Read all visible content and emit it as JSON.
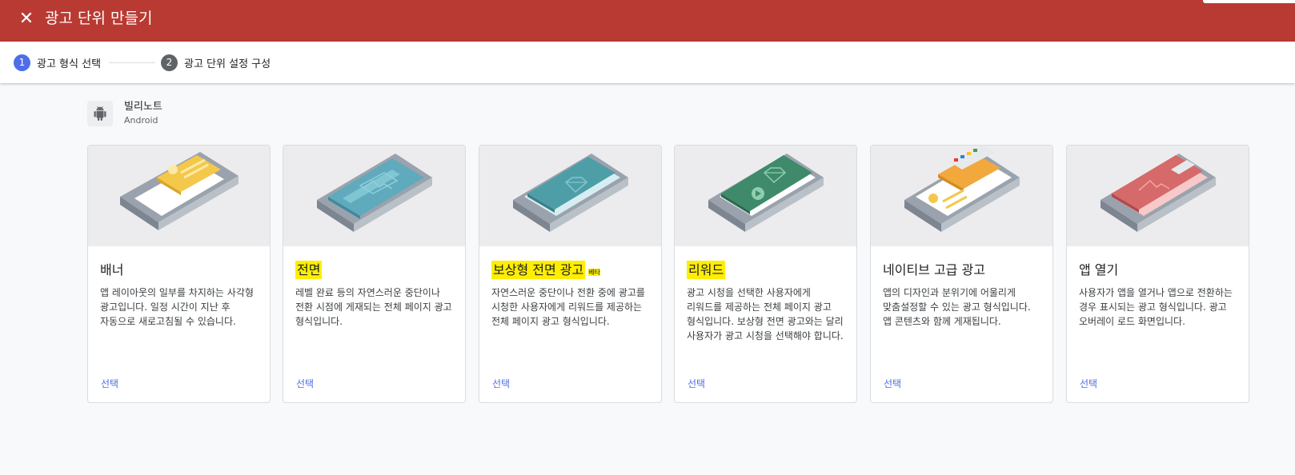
{
  "header": {
    "close_icon": "close-icon",
    "title": "광고 단위 만들기",
    "background": "#b93a32"
  },
  "stepper": {
    "steps": [
      {
        "number": "1",
        "label": "광고 형식 선택",
        "state": "active"
      },
      {
        "number": "2",
        "label": "광고 단위 설정 구성",
        "state": "inactive"
      }
    ]
  },
  "app": {
    "icon": "android-icon",
    "name": "빌리노트",
    "platform": "Android"
  },
  "cards": [
    {
      "title": "배너",
      "highlight": false,
      "badge": "",
      "description": "앱 레이아웃의 일부를 차지하는 사각형 광고입니다. 일정 시간이 지난 후 자동으로 새로고침될 수 있습니다.",
      "select_label": "선택",
      "illustration": "banner-illustration"
    },
    {
      "title": "전면",
      "highlight": true,
      "badge": "",
      "description": "레벨 완료 등의 자연스러운 중단이나 전환 시점에 게재되는 전체 페이지 광고 형식입니다.",
      "select_label": "선택",
      "illustration": "interstitial-illustration"
    },
    {
      "title": "보상형 전면 광고",
      "highlight": true,
      "badge": "베타",
      "description": "자연스러운 중단이나 전환 중에 광고를 시청한 사용자에게 리워드를 제공하는 전체 페이지 광고 형식입니다.",
      "select_label": "선택",
      "illustration": "rewarded-interstitial-illustration"
    },
    {
      "title": "리워드",
      "highlight": true,
      "badge": "",
      "description": "광고 시청을 선택한 사용자에게 리워드를 제공하는 전체 페이지 광고 형식입니다. 보상형 전면 광고와는 달리 사용자가 광고 시청을 선택해야 합니다.",
      "select_label": "선택",
      "illustration": "rewarded-illustration"
    },
    {
      "title": "네이티브 고급 광고",
      "highlight": false,
      "badge": "",
      "description": "앱의 디자인과 분위기에 어울리게 맞춤설정할 수 있는 광고 형식입니다. 앱 콘텐츠와 함께 게재됩니다.",
      "select_label": "선택",
      "illustration": "native-advanced-illustration"
    },
    {
      "title": "앱 열기",
      "highlight": false,
      "badge": "",
      "description": "사용자가 앱을 열거나 앱으로 전환하는 경우 표시되는 광고 형식입니다. 광고 오버레이 로드 화면입니다.",
      "select_label": "선택",
      "illustration": "app-open-illustration"
    }
  ],
  "colors": {
    "step_active": "#4e6ee8",
    "step_inactive": "#5f6368",
    "link": "#4c6ee6",
    "highlight": "#ffee00"
  }
}
